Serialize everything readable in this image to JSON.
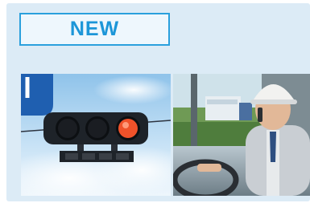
{
  "badge": {
    "label": "NEW"
  },
  "colors": {
    "panel": "#dcebf6",
    "accent": "#1c96d8",
    "signal_red": "#f0522a"
  },
  "photos": [
    {
      "subject": "traffic-signal"
    },
    {
      "subject": "truck-driver-phone"
    }
  ]
}
